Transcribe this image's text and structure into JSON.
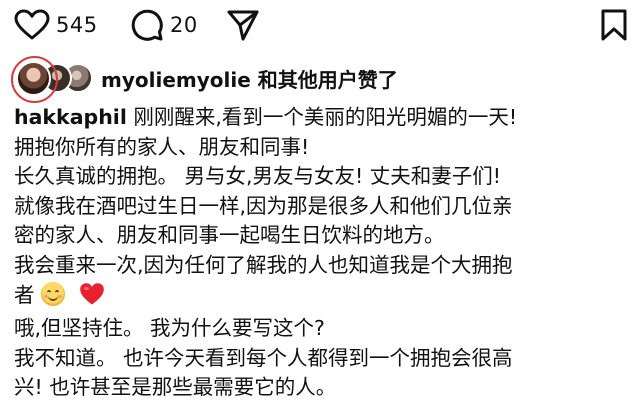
{
  "actions": {
    "like_count": "545",
    "comment_count": "20"
  },
  "likes": {
    "username": "myoliemyolie",
    "suffix": " 和其他用户赞了"
  },
  "caption": {
    "author": "hakkaphil",
    "lines": [
      " 刚刚醒来,看到一个美丽的阳光明媚的一天!",
      "拥抱你所有的家人、朋友和同事!",
      "长久真诚的拥抱。 男与女,男友与女友! 丈夫和妻子们!",
      "就像我在酒吧过生日一样,因为那是很多人和他们几位亲",
      "密的家人、朋友和同事一起喝生日饮料的地方。",
      "我会重来一次,因为任何了解我的人也知道我是个大拥抱",
      "者",
      "哦,但坚持住。 我为什么要写这个?",
      "我不知道。 也许今天看到每个人都得到一个拥抱会很高",
      "兴! 也许甚至是那些最需要它的人。"
    ]
  },
  "icons": {
    "heart": "heart-outline-icon",
    "comment": "comment-bubble-icon",
    "share": "paper-plane-icon",
    "save": "bookmark-icon",
    "emoji_smile": "smiling-face-emoji",
    "emoji_heart": "red-heart-emoji"
  },
  "colors": {
    "text": "#111111",
    "heart_emoji": "#e8202f",
    "annotation_circle": "#d83a3a"
  }
}
